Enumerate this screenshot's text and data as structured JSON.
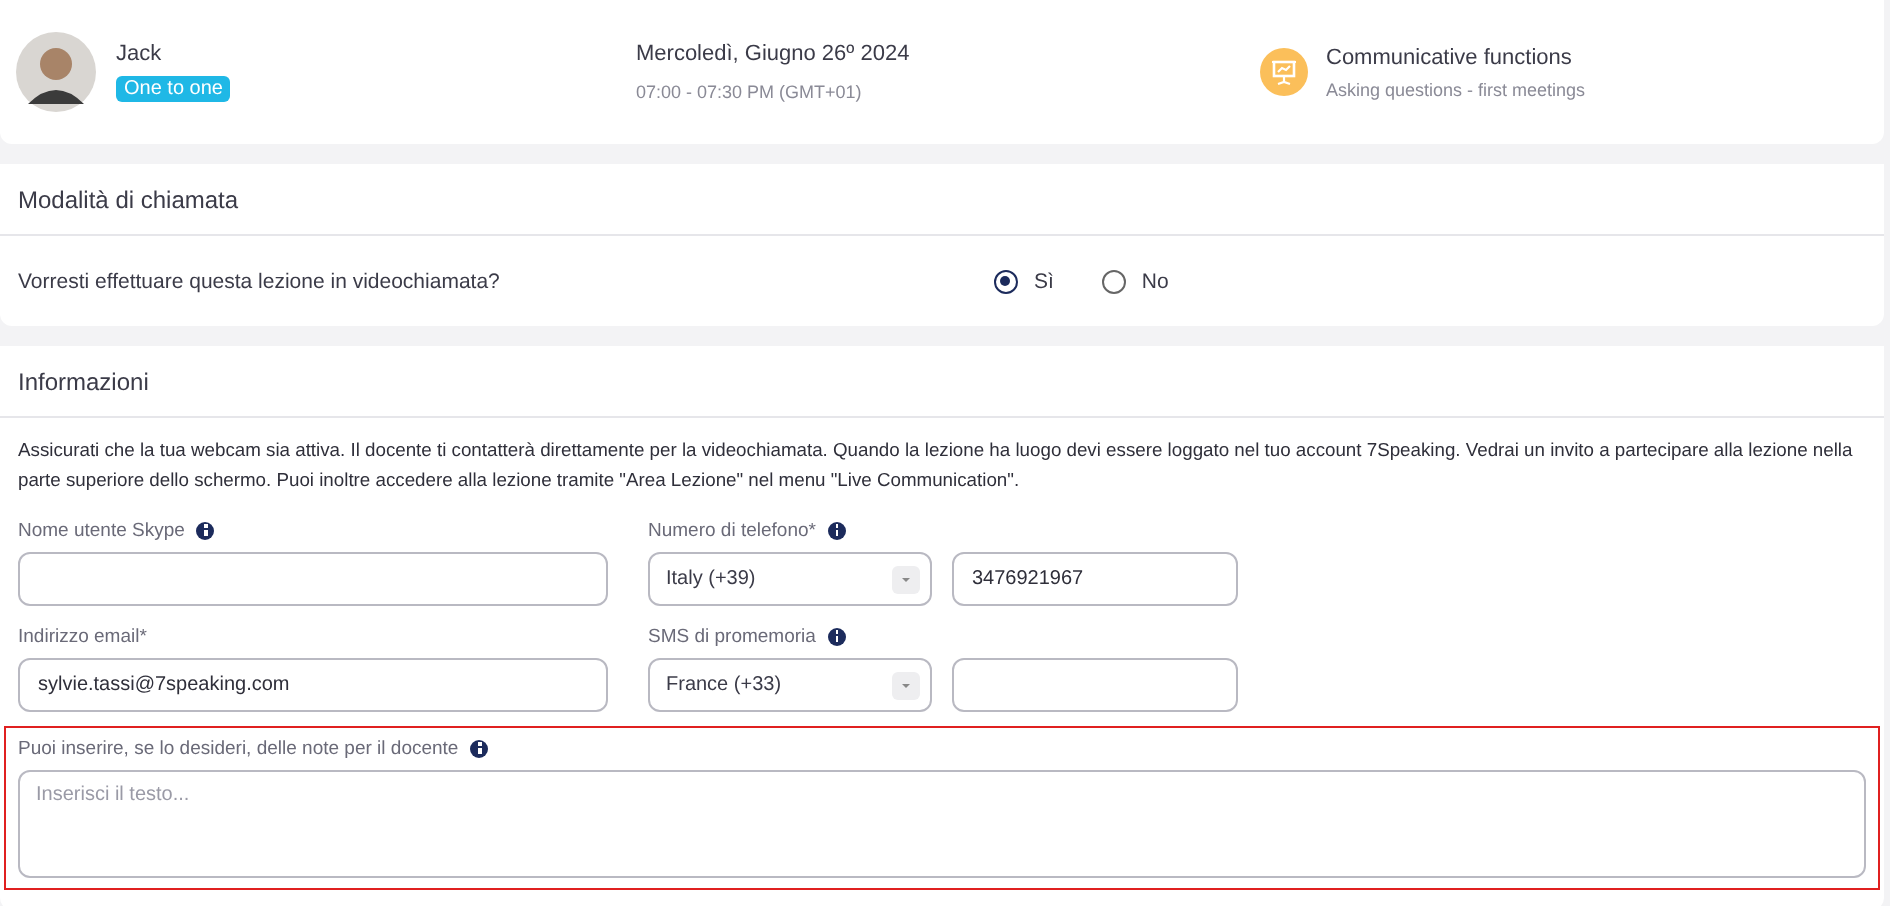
{
  "lesson": {
    "teacher": "Jack",
    "badge": "One to one",
    "date": "Mercoledì, Giugno 26º 2024",
    "time": "07:00 - 07:30 PM (GMT+01)",
    "topic": "Communicative functions",
    "subtopic": "Asking questions - first meetings"
  },
  "call_mode": {
    "title": "Modalità di chiamata",
    "question": "Vorresti effettuare questa lezione in videochiamata?",
    "options": [
      {
        "label": "Sì",
        "selected": true
      },
      {
        "label": "No",
        "selected": false
      }
    ]
  },
  "info": {
    "title": "Informazioni",
    "text": "Assicurati che la tua webcam sia attiva. Il docente ti contatterà direttamente per la videochiamata. Quando la lezione ha luogo devi essere loggato nel tuo account 7Speaking. Vedrai un invito a partecipare alla lezione nella parte superiore dello schermo. Puoi inoltre accedere alla lezione tramite \"Area Lezione\" nel menu \"Live Communication\".",
    "skype": {
      "label": "Nome utente Skype"
    },
    "phone": {
      "label": "Numero di telefono*",
      "country": "Italy (+39)",
      "value": "3476921967"
    },
    "email": {
      "label": "Indirizzo email*",
      "value": "sylvie.tassi@7speaking.com"
    },
    "sms": {
      "label": "SMS di promemoria",
      "country": "France (+33)"
    },
    "notes": {
      "label": "Puoi inserire, se lo desideri, delle note per il docente",
      "placeholder": "Inserisci il testo...",
      "highlighted": true
    }
  }
}
